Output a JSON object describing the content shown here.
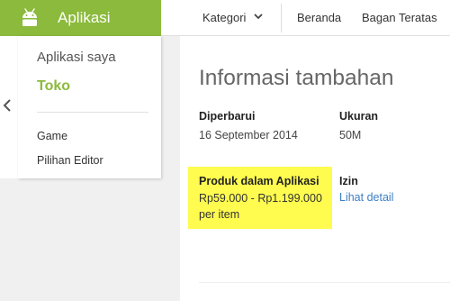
{
  "topbar": {
    "brand_label": "Aplikasi",
    "brand_icon": "android-icon",
    "brand_color": "#8bba3c",
    "nav": {
      "kategori": "Kategori",
      "beranda": "Beranda",
      "bagan_teratas": "Bagan Teratas"
    }
  },
  "side_menu": {
    "my_apps": "Aplikasi saya",
    "store": "Toko",
    "game": "Game",
    "editors_choice": "Pilihan Editor"
  },
  "info": {
    "title": "Informasi tambahan",
    "updated_label": "Diperbarui",
    "updated_value": "16 September 2014",
    "size_label": "Ukuran",
    "size_value": "50M",
    "iap_label": "Produk dalam Aplikasi",
    "iap_range": "Rp59.000 - Rp1.199.000",
    "iap_unit": "per item",
    "permissions_label": "Izin",
    "permissions_link": "Lihat detail",
    "highlight_color": "#fffb4f",
    "link_color": "#3d7fc6"
  }
}
